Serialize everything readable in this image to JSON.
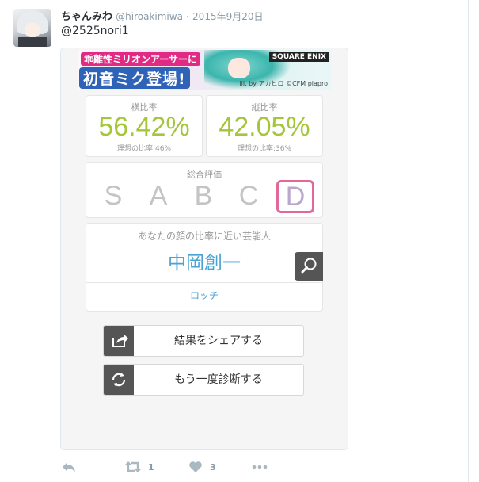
{
  "tweet": {
    "display_name": "ちゃんみわ",
    "handle": "@hiroakimiwa",
    "separator": "·",
    "date": "2015年9月20日",
    "text": "@2525nori1"
  },
  "banner": {
    "line1": "乖離性ミリオンアーサーに",
    "line2": "初音ミク登場!",
    "publisher": "SQUARE ENIX",
    "credit": "ill. by アカヒロ ©CFM piapro"
  },
  "ratios": {
    "horizontal": {
      "label": "横比率",
      "value": "56.42%",
      "ideal": "理想の比率:46%"
    },
    "vertical": {
      "label": "縦比率",
      "value": "42.05%",
      "ideal": "理想の比率:36%"
    }
  },
  "evaluation": {
    "title": "総合評価",
    "grades": [
      "S",
      "A",
      "B",
      "C",
      "D"
    ],
    "selected": "D"
  },
  "celebrity": {
    "title": "あなたの顔の比率に近い芸能人",
    "name": "中岡創一",
    "group": "ロッチ"
  },
  "actions": {
    "share": "結果をシェアする",
    "retry": "もう一度診断する"
  },
  "tweet_actions": {
    "retweet_count": "1",
    "like_count": "3"
  },
  "colors": {
    "ratio_green": "#a5c63b",
    "grade_highlight": "#e2689a",
    "link_blue": "#4aa3d3"
  },
  "icons": [
    "reply-icon",
    "retweet-icon",
    "heart-icon",
    "more-icon",
    "share-icon",
    "refresh-icon",
    "search-icon"
  ]
}
